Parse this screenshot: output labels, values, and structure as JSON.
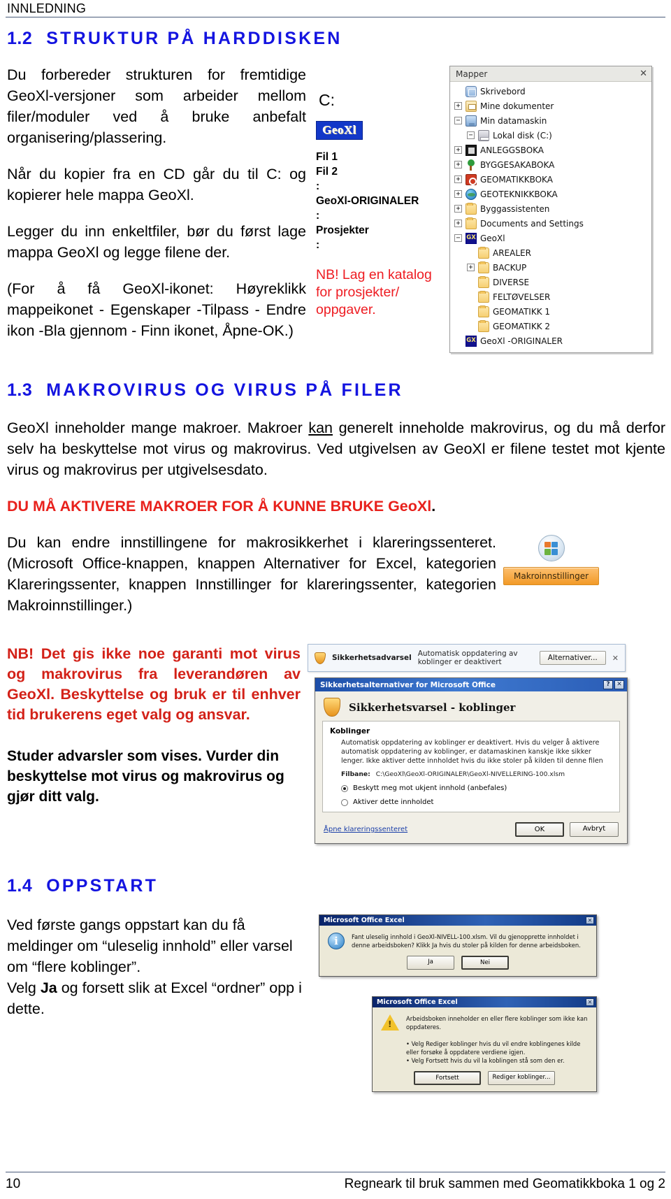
{
  "running_head": "INNLEDNING",
  "section_12": {
    "number": "1.2",
    "title": "STRUKTUR PÅ HARDDISKEN",
    "paragraphs": [
      "Du forbereder strukturen for fremtidige GeoXl-versjoner som arbeider mellom filer/moduler ved å bruke anbefalt organisering/plassering.",
      "Når du kopier fra en CD går du til C: og kopierer hele mappa GeoXl.",
      "Legger du inn enkeltfiler, bør du først lage mappa GeoXl og legge filene der.",
      "(For å få GeoXl-ikonet: Høyreklikk mappeikonet - Egenskaper -Tilpass - Endre ikon -Bla gjennom - Finn ikonet, Åpne-OK.)"
    ],
    "drive_label": "C:",
    "logo_text": "GeoXl",
    "tree_list": [
      "Fil 1",
      "Fil 2",
      ":",
      "GeoXl-ORIGINALER",
      ":",
      "Prosjekter",
      ":"
    ],
    "nb_note": "NB! Lag en katalog for prosjekter/ oppgaver."
  },
  "explorer": {
    "title": "Mapper",
    "close_label": "✕",
    "nodes": [
      {
        "label": "Skrivebord",
        "icon": "desktop-icon",
        "expander": "",
        "indent": 0
      },
      {
        "label": "Mine dokumenter",
        "icon": "documents-icon",
        "expander": "+",
        "indent": 1
      },
      {
        "label": "Min datamaskin",
        "icon": "computer-icon",
        "expander": "−",
        "indent": 1
      },
      {
        "label": "Lokal disk (C:)",
        "icon": "disk-icon",
        "expander": "−",
        "indent": 2
      },
      {
        "label": "ANLEGGSBOKA",
        "icon": "anlegg-icon",
        "expander": "+",
        "indent": 1
      },
      {
        "label": "BYGGESAKABOKA",
        "icon": "tree-icon",
        "expander": "+",
        "indent": 1
      },
      {
        "label": "GEOMATIKKBOKA",
        "icon": "geomatikk-icon",
        "expander": "+",
        "indent": 1
      },
      {
        "label": "GEOTEKNIKKBOKA",
        "icon": "globe-icon",
        "expander": "+",
        "indent": 1
      },
      {
        "label": "Byggassistenten",
        "icon": "folder-icon",
        "expander": "+",
        "indent": 1
      },
      {
        "label": "Documents and Settings",
        "icon": "folder-icon",
        "expander": "+",
        "indent": 1
      },
      {
        "label": "GeoXl",
        "icon": "geoxl-icon",
        "expander": "−",
        "indent": 1
      },
      {
        "label": "AREALER",
        "icon": "folder-icon",
        "expander": "",
        "indent": 2
      },
      {
        "label": "BACKUP",
        "icon": "folder-icon",
        "expander": "+",
        "indent": 2
      },
      {
        "label": "DIVERSE",
        "icon": "folder-icon",
        "expander": "",
        "indent": 2
      },
      {
        "label": "FELTØVELSER",
        "icon": "folder-icon",
        "expander": "",
        "indent": 2
      },
      {
        "label": "GEOMATIKK 1",
        "icon": "folder-icon",
        "expander": "",
        "indent": 2
      },
      {
        "label": "GEOMATIKK 2",
        "icon": "folder-icon",
        "expander": "",
        "indent": 2
      },
      {
        "label": "GeoXl -ORIGINALER",
        "icon": "geoxl-icon",
        "expander": "",
        "indent": 1
      }
    ]
  },
  "section_13": {
    "number": "1.3",
    "title": "MAKROVIRUS OG VIRUS PÅ FILER",
    "para1_a": "GeoXl inneholder mange makroer. Makroer ",
    "para1_underline": "kan",
    "para1_b": " generelt inneholde makrovirus, og du må derfor selv ha beskyttelse mot virus og makrovirus. Ved utgivelsen av GeoXl er filene testet mot kjente virus og makrovirus per utgivelsesdato.",
    "red_line": "DU MÅ AKTIVERE MAKROER FOR Å KUNNE BRUKE GeoXl",
    "red_line_period": ".",
    "para2": "Du kan endre innstillingene for makrosikkerhet i klareringssenteret. (Microsoft Office-knappen, knappen Alternativer for Excel, kategorien Klareringssenter, knappen Innstillinger for klareringssenter, kategorien Makroinnstillinger.)",
    "makro_button": "Makroinnstillinger",
    "nb_red": "NB! Det gis ikke noe garanti mot virus og makrovirus fra leverandøren av GeoXl. Beskyttelse og bruk er til enhver tid brukerens eget valg og ansvar.",
    "advice_bold": "Studer advarsler som vises. Vurder din beskyttelse mot virus og makrovirus og gjør ditt valg."
  },
  "warn_bar": {
    "icon": "shield-icon",
    "bold": "Sikkerhetsadvarsel",
    "text": "Automatisk oppdatering av koblinger er deaktivert",
    "button": "Alternativer...",
    "close": "✕"
  },
  "security_dialog": {
    "titlebar": "Sikkerhetsalternativer for Microsoft Office",
    "help_btn": "?",
    "close_btn": "✕",
    "heading": "Sikkerhetsvarsel - koblinger",
    "section_label": "Koblinger",
    "body": "Automatisk oppdatering av koblinger er deaktivert. Hvis du velger å aktivere automatisk oppdatering av koblinger, er datamaskinen kanskje ikke sikker lenger. Ikke aktiver dette innholdet hvis du ikke stoler på kilden til denne filen",
    "file_key": "Filbane:",
    "file_value": "C:\\GeoXl\\GeoXl-ORIGINALER\\GeoXl-NIVELLERING-100.xlsm",
    "radio1": "Beskytt meg mot ukjent innhold (anbefales)",
    "radio2": "Aktiver dette innholdet",
    "radio1_selected": true,
    "link": "Åpne klareringssenteret",
    "ok": "OK",
    "cancel": "Avbryt"
  },
  "section_14": {
    "number": "1.4",
    "title": "OPPSTART",
    "para_a": "Ved første gangs oppstart kan du få meldinger om “uleselig innhold” eller varsel om “flere koblinger”.",
    "para_b_1": "Velg ",
    "para_b_bold": "Ja",
    "para_b_2": " og forsett slik at Excel “ordner” opp i dette."
  },
  "excel_dialog_1": {
    "titlebar": "Microsoft Office Excel",
    "close_btn": "✕",
    "icon": "info-icon",
    "text": "Fant uleselig innhold i GeoXl-NIVELL-100.xlsm. Vil du gjenopprette innholdet i denne arbeidsboken? Klikk Ja hvis du stoler på kilden for denne arbeidsboken.",
    "btn_yes": "Ja",
    "btn_no": "Nei"
  },
  "excel_dialog_2": {
    "titlebar": "Microsoft Office Excel",
    "close_btn": "✕",
    "icon": "warning-icon",
    "text": "Arbeidsboken inneholder en eller flere koblinger som ikke kan oppdateres.",
    "bullet1": "• Velg Rediger koblinger hvis du vil endre koblingenes kilde eller forsøke å oppdatere verdiene igjen.",
    "bullet2": "• Velg Fortsett hvis du vil la koblingen stå som den er.",
    "btn_continue": "Fortsett",
    "btn_edit": "Rediger koblinger..."
  },
  "footer": {
    "page_number": "10",
    "text": "Regneark til bruk sammen med Geomatikkboka 1 og 2"
  }
}
